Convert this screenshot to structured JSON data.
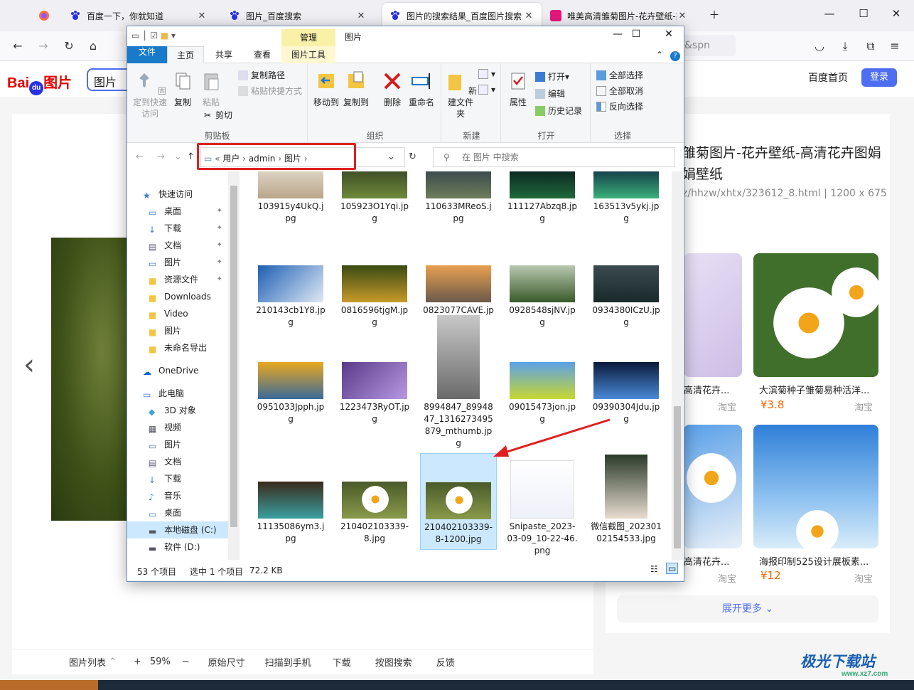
{
  "browser": {
    "tabs": [
      {
        "title": "百度一下，你就知道"
      },
      {
        "title": "图片_百度搜索"
      },
      {
        "title": "图片的搜索结果_百度图片搜索"
      },
      {
        "title": "唯美高清雏菊图片-花卉壁纸-高"
      }
    ],
    "url_fragment": "&spn"
  },
  "baidu": {
    "logo_text": "Bai",
    "logo_text2": "图片",
    "search_value": "图片",
    "home_link": "百度首页",
    "login_button": "登录",
    "detail_title": "雏菊图片-花卉壁纸-高清花卉图娟娟壁纸",
    "detail_url": "z/hhzw/xhtx/323612_8.html",
    "detail_size": "1200 x 675",
    "cards": [
      {
        "caption": "高清花卉...",
        "source": "淘宝",
        "price": ""
      },
      {
        "caption": "大滨菊种子雏菊易种活洋...",
        "source": "淘宝",
        "price": "¥3.8"
      },
      {
        "caption": "高清花卉...",
        "source": "淘宝",
        "price": ""
      },
      {
        "caption": "海报印制525设计展板素...",
        "source": "淘宝",
        "price": "¥12"
      }
    ],
    "more_button": "展开更多",
    "viewer_toolbar": {
      "list": "图片列表",
      "zoom_in": "+",
      "zoom": "59%",
      "zoom_out": "−",
      "original": "原始尺寸",
      "scan": "扫描到手机",
      "download": "下载",
      "search_by_image": "按图搜索",
      "feedback": "反馈"
    }
  },
  "explorer": {
    "manage_tab": "管理",
    "window_title": "图片",
    "tabs": {
      "file": "文件",
      "home": "主页",
      "share": "共享",
      "view": "查看",
      "picture_tools": "图片工具"
    },
    "ribbon": {
      "pin": "固定到快速访问",
      "copy": "复制",
      "paste": "粘贴",
      "copy_path": "复制路径",
      "paste_shortcut": "粘贴快捷方式",
      "cut": "剪切",
      "clipboard": "剪贴板",
      "move_to": "移动到",
      "copy_to": "复制到",
      "delete": "删除",
      "rename": "重命名",
      "organize": "组织",
      "new_folder": "新建文件夹",
      "new": "新建",
      "properties": "属性",
      "open": "打开",
      "edit": "编辑",
      "history": "历史记录",
      "open_group": "打开",
      "select_all": "全部选择",
      "select_none": "全部取消",
      "invert": "反向选择",
      "select_group": "选择"
    },
    "breadcrumb": [
      "用户",
      "admin",
      "图片"
    ],
    "search_placeholder": "在 图片 中搜索",
    "nav": [
      {
        "label": "快速访问",
        "pinned": false
      },
      {
        "label": "桌面",
        "pinned": true
      },
      {
        "label": "下载",
        "pinned": true
      },
      {
        "label": "文档",
        "pinned": true
      },
      {
        "label": "图片",
        "pinned": true
      },
      {
        "label": "资源文件",
        "pinned": true
      },
      {
        "label": "Downloads",
        "pinned": false
      },
      {
        "label": "Video",
        "pinned": false
      },
      {
        "label": "图片",
        "pinned": false
      },
      {
        "label": "未命名导出",
        "pinned": false
      },
      {
        "label": "OneDrive",
        "pinned": false
      },
      {
        "label": "此电脑",
        "pinned": false
      },
      {
        "label": "3D 对象",
        "pinned": false
      },
      {
        "label": "视频",
        "pinned": false
      },
      {
        "label": "图片",
        "pinned": false
      },
      {
        "label": "文档",
        "pinned": false
      },
      {
        "label": "下载",
        "pinned": false
      },
      {
        "label": "音乐",
        "pinned": false
      },
      {
        "label": "桌面",
        "pinned": false
      },
      {
        "label": "本地磁盘 (C:)",
        "pinned": false
      },
      {
        "label": "软件 (D:)",
        "pinned": false
      }
    ],
    "files": [
      {
        "name": "103915y4UkQ.jpg"
      },
      {
        "name": "105923O1Yqi.jpg"
      },
      {
        "name": "110633MReoS.jpg"
      },
      {
        "name": "111127Abzq8.jpg"
      },
      {
        "name": "163513v5ykj.jpg"
      },
      {
        "name": "210143cb1Y8.jpg"
      },
      {
        "name": "0816596tjgM.jpg"
      },
      {
        "name": "0823077CAVE.jpg"
      },
      {
        "name": "0928548sjNV.jpg"
      },
      {
        "name": "0934380ICzU.jpg"
      },
      {
        "name": "0951033Jpph.jpg"
      },
      {
        "name": "1223473RyOT.jpg"
      },
      {
        "name": "8994847_8994847_1316273495879_mthumb.jpg"
      },
      {
        "name": "09015473jon.jpg"
      },
      {
        "name": "09390304Jdu.jpg"
      },
      {
        "name": "11135086ym3.jpg"
      },
      {
        "name": "210402103339-8.jpg"
      },
      {
        "name": "210402103339-8-1200.jpg"
      },
      {
        "name": "Snipaste_2023-03-09_10-22-46.png"
      },
      {
        "name": "微信截图_20230102154533.jpg"
      }
    ],
    "status": {
      "count": "53 个项目",
      "selected": "选中 1 个项目",
      "size": "72.2 KB"
    }
  },
  "watermark": {
    "text": "极光下载站",
    "url": "www.xz7.com"
  },
  "colors": {
    "accent": "#4e6ef2",
    "explorer_file_tab": "#1979ca",
    "highlight": "#e02020",
    "selection": "#cce8ff",
    "price": "#ff6600"
  }
}
